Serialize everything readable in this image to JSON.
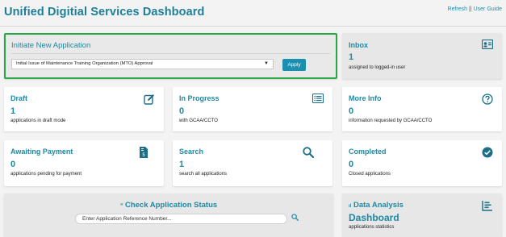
{
  "header": {
    "title": "Unified Digitial Services Dashboard",
    "refresh_label": "Refresh",
    "separator": "||",
    "user_guide_label": "User Guide"
  },
  "initiate": {
    "heading": "Initiate New Application",
    "selected_option": "Initial Issue of Maintenance Training Organization (MTO) Approval",
    "apply_label": "Apply"
  },
  "inbox": {
    "title": "Inbox",
    "count": "1",
    "sub": "assigned to logged-in user",
    "icon": "id-card-icon"
  },
  "cards": [
    {
      "title": "Draft",
      "count": "1",
      "sub": "applications in draft mode",
      "icon": "edit-icon"
    },
    {
      "title": "In Progress",
      "count": "0",
      "sub": "with GCAA/CCTO",
      "icon": "list-icon"
    },
    {
      "title": "More Info",
      "count": "0",
      "sub": "information requested by GCAA/CCTO",
      "icon": "question-icon"
    },
    {
      "title": "Awaiting Payment",
      "count": "0",
      "sub": "applications pending for payment",
      "icon": "invoice-icon"
    },
    {
      "title": "Search",
      "count": "1",
      "sub": "search all applications",
      "icon": "search-icon"
    },
    {
      "title": "Completed",
      "count": "0",
      "sub": "Closed applications",
      "icon": "check-circle-icon"
    }
  ],
  "check_status": {
    "heading": "Check Application Status",
    "input_placeholder": "Enter Application Reference Number..."
  },
  "data_analysis": {
    "title": "Data Analysis",
    "count": "Dashboard",
    "sub": "applications statistics"
  },
  "colors": {
    "accent": "#1c8aa5",
    "highlight_border": "#28a745",
    "button": "#1a8fb0"
  }
}
